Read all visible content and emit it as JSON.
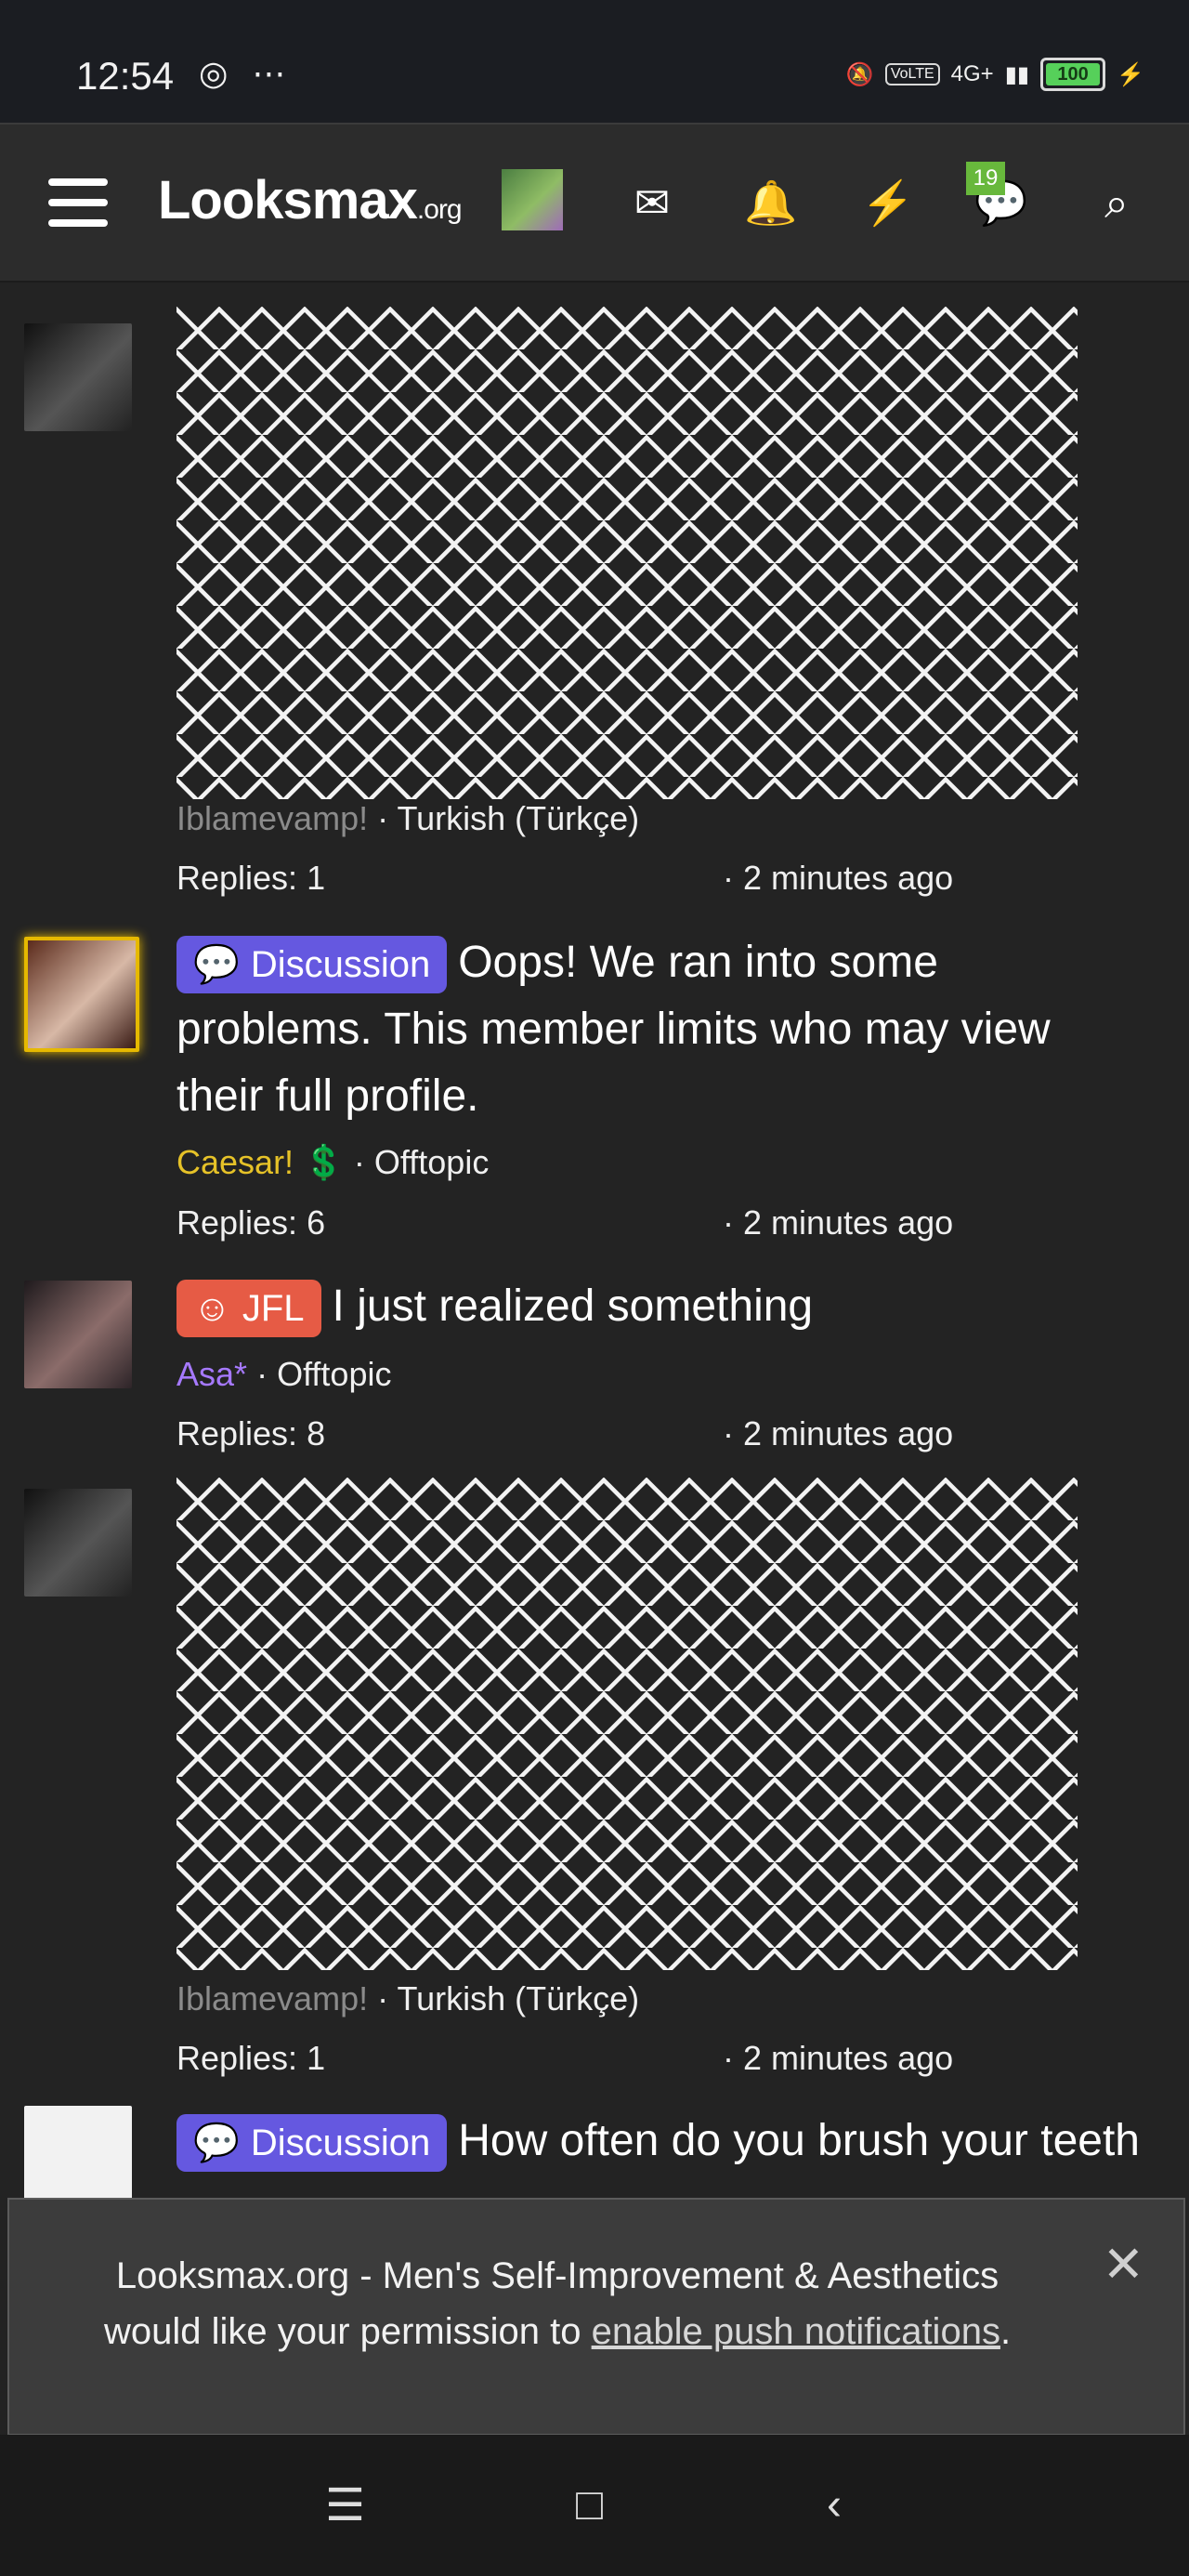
{
  "status_bar": {
    "time": "12:54",
    "left_indicators": "◎ ⋯",
    "right_indicators": [
      "🔕",
      "VoLTE",
      "4G+",
      "▮▮"
    ],
    "battery": "100",
    "battery_level": 1.0
  },
  "nav": {
    "site_name": "Looksmax",
    "site_suffix": ".org",
    "conversation_badge": "19"
  },
  "threads": [
    {
      "user": "Iblamevamp!",
      "forum": "Turkish (Türkçe)",
      "replies": "Replies: 1",
      "time": "· 2 minutes ago"
    },
    {
      "tag": "Discussion",
      "title": "Oops! We ran into some problems. This member limits who may view their full profile.",
      "user": "Caesar!",
      "user_badge": "💲",
      "forum": "Offtopic",
      "replies": "Replies: 6",
      "time": "· 2 minutes ago"
    },
    {
      "tag": "JFL",
      "title": "I just realized something",
      "user": "Asa*",
      "forum": "Offtopic",
      "replies": "Replies: 8",
      "time": "· 2 minutes ago"
    },
    {
      "user": "Iblamevamp!",
      "forum": "Turkish (Türkçe)",
      "replies": "Replies: 1",
      "time": "· 2 minutes ago"
    },
    {
      "tag": "Discussion",
      "title": "How often do you brush your teeth"
    }
  ],
  "notification_prompt": {
    "text": "Looksmax.org - Men's Self-Improvement & Aesthetics would like your permission to",
    "link": "enable push notifications",
    "trailing": "."
  },
  "icons": {
    "menu": "menu-icon",
    "mail": "mail-icon",
    "bell": "bell-icon",
    "bolt": "bolt-icon",
    "chat": "chat-icon",
    "search": "search-icon",
    "close": "close-icon"
  }
}
